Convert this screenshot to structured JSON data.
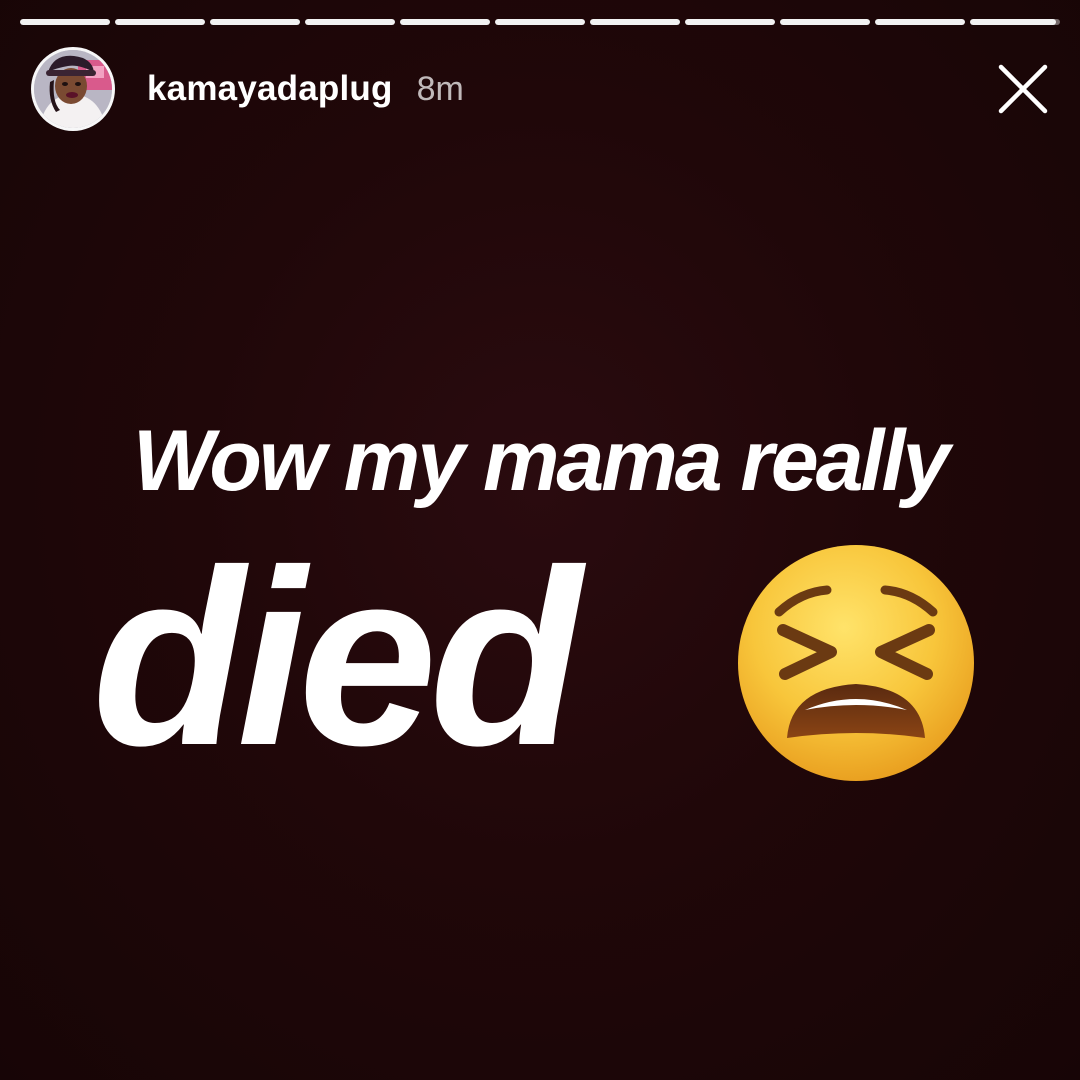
{
  "story": {
    "segments": [
      {
        "progress": 1
      },
      {
        "progress": 1
      },
      {
        "progress": 1
      },
      {
        "progress": 1
      },
      {
        "progress": 1
      },
      {
        "progress": 1
      },
      {
        "progress": 1
      },
      {
        "progress": 1
      },
      {
        "progress": 1
      },
      {
        "progress": 1
      },
      {
        "progress": 0.95
      }
    ]
  },
  "header": {
    "username": "kamayadaplug",
    "time": "8m",
    "close_icon": "close-icon"
  },
  "content": {
    "line1": "Wow my mama really",
    "line2": "died",
    "emoji": "tired-face-emoji"
  },
  "colors": {
    "background": "#1e0709",
    "text": "#ffffff",
    "emoji_yellow": "#f7c23a"
  }
}
